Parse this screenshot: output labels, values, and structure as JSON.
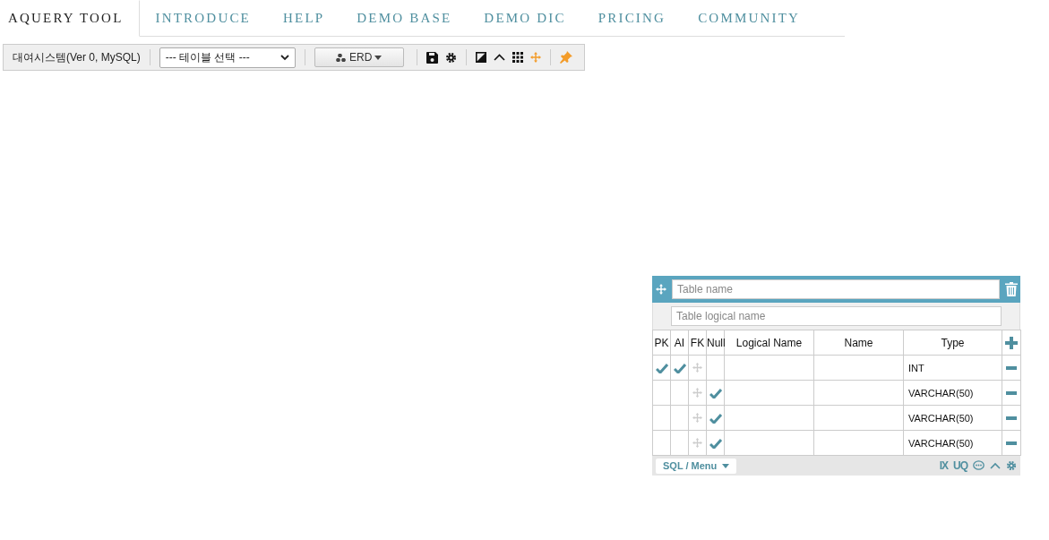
{
  "nav": {
    "tabs": [
      {
        "label": "AQUERY TOOL",
        "selected": true
      },
      {
        "label": "INTRODUCE",
        "selected": false
      },
      {
        "label": "HELP",
        "selected": false
      },
      {
        "label": "DEMO BASE",
        "selected": false
      },
      {
        "label": "DEMO DIC",
        "selected": false
      },
      {
        "label": "PRICING",
        "selected": false
      },
      {
        "label": "COMMUNITY",
        "selected": false
      }
    ]
  },
  "toolbar": {
    "project": "대여시스템(Ver 0, MySQL)",
    "table_select": "--- 테이블 선택 ---",
    "erd_button": "ERD"
  },
  "table_card": {
    "name_placeholder": "Table name",
    "logical_placeholder": "Table logical name",
    "columns": [
      "PK",
      "AI",
      "FK",
      "Null",
      "Logical Name",
      "Name",
      "Type"
    ],
    "rows": [
      {
        "pk": true,
        "ai": true,
        "null": false,
        "type": "INT"
      },
      {
        "pk": false,
        "ai": false,
        "null": true,
        "type": "VARCHAR(50)"
      },
      {
        "pk": false,
        "ai": false,
        "null": true,
        "type": "VARCHAR(50)"
      },
      {
        "pk": false,
        "ai": false,
        "null": true,
        "type": "VARCHAR(50)"
      }
    ],
    "menu_button": "SQL / Menu",
    "index_button": "IX",
    "unique_button": "UQ"
  }
}
